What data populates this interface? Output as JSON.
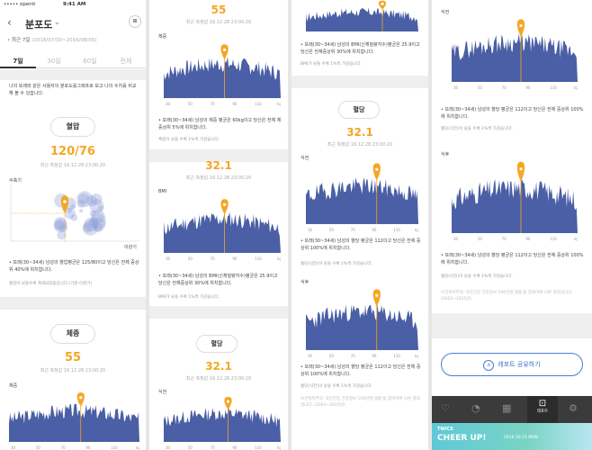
{
  "status_bar": {
    "carrier": "openit",
    "time": "9:41 AM"
  },
  "header": {
    "title": "분포도",
    "period": "최근 7일",
    "date_range": "(2016/07/30~2016/08/05)"
  },
  "tabs": [
    {
      "label": "7일",
      "active": true
    },
    {
      "label": "30일"
    },
    {
      "label": "60일"
    },
    {
      "label": "전체"
    }
  ],
  "intro": "나의 또래와 같은 사용자의 분포도를그래프로 보고 나의 수치를 비교해 볼 수 있습니다.",
  "measured_label": "최근 측정값 16.12.28 23:00:20",
  "blood_pressure": {
    "title": "혈압",
    "value": "120/76",
    "y_label": "수축기",
    "x_label": "이완기",
    "bullet": "또래(30~34세) 남성의 혈압평균은 125/80이고 당신은 전체 중상위 40%에 위치합니다.",
    "note": "혈압이 낮을수록 제게되었을입니다.(기준-이완기)"
  },
  "weight": {
    "title": "체중",
    "value": "55",
    "unit_label": "체중",
    "bullet": "또래(30~34세) 남성의 체중 평균은 60kg이고 당신은 전체 체중상위 5%에 위치합니다.",
    "note": "체중이 낮을 수록 1%씩 가감습니다."
  },
  "bmi": {
    "value": "32.1",
    "unit_label": "BMI",
    "bullet": "또래(30~34세) 남성의 BMI(신체질량지수)평균은 25.9이고 당신은 전체중상위 30%에 위치합니다.",
    "note": "BMI가 낮을 수록 1%씩 가감습니다."
  },
  "glucose": {
    "title": "혈당",
    "value": "32.1",
    "before_label": "식전",
    "after_label": "식후",
    "bullet": "또래(30~34세) 남성의 혈당 평균은 112이고 당신은 전체 중상위 100%에 위치합니다.",
    "note": "혈당(식전)이 낮을 수록 1%씩 가감습니다.",
    "source": "보건복지부의 '국민건강 건강정보 100만명 샘플'을 참여하여 나온 결과입니다. (2003~2015년)"
  },
  "axis": {
    "ticks": [
      "30",
      "50",
      "70",
      "90",
      "110",
      "kg"
    ]
  },
  "share_button": "레포트 공유하기",
  "bottom_nav": [
    {
      "label": ""
    },
    {
      "label": ""
    },
    {
      "label": ""
    },
    {
      "label": "레포트",
      "active": true
    },
    {
      "label": ""
    }
  ],
  "banner": {
    "brand": "TWICE",
    "title": "CHEER UP!",
    "date": "2016.10.21 MON"
  },
  "colors": {
    "accent": "#f5a623",
    "chart": "#4a5fa5",
    "nav_bg": "#3b3b3b"
  }
}
